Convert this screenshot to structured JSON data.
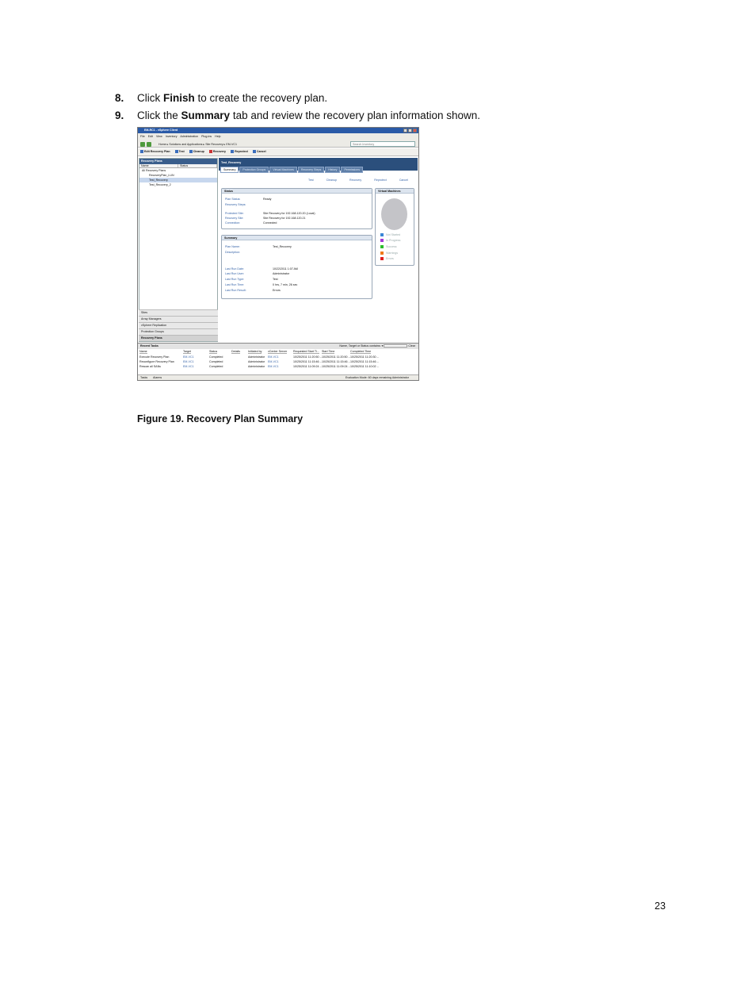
{
  "steps": [
    {
      "number": "8.",
      "before": "Click ",
      "bold": "Finish",
      "after": " to create the recovery plan."
    },
    {
      "number": "9.",
      "before": "Click the ",
      "bold": "Summary",
      "after": " tab and review the recovery plan information shown."
    }
  ],
  "caption": "Figure 19. Recovery Plan Summary",
  "page_number": "23",
  "screenshot": {
    "title": "EM-RC1 - vSphere Client",
    "menu": [
      "File",
      "Edit",
      "View",
      "Inventory",
      "Administration",
      "Plug-ins",
      "Help"
    ],
    "breadcrumb": [
      "Home",
      "Solutions and Applications",
      "Site Recovery",
      "EM-VC1"
    ],
    "search_placeholder": "Search Inventory",
    "toolbar": [
      "Edit Recovery Plan",
      "Test",
      "Cleanup",
      "Recovery",
      "Reprotect",
      "Cancel"
    ],
    "left_panel": {
      "title": "Recovery Plans",
      "columns": [
        "Name",
        "Status"
      ],
      "tree": [
        "All Recovery Plans",
        "RecoveryPlan_LUN",
        "Test_Recovery",
        "Test_Recovery_2"
      ],
      "selected_index": 2,
      "accordion": [
        "Sites",
        "Array Managers",
        "vSphere Replication",
        "Protection Groups",
        "Recovery Plans"
      ]
    },
    "plan_name": "Test_Recovery",
    "tabs": [
      "Summary",
      "Protection Groups",
      "Virtual Machines",
      "Recovery Steps",
      "History",
      "Permissions"
    ],
    "actions": [
      "Test",
      "Cleanup",
      "Recovery",
      "Reprotect",
      "Cancel"
    ],
    "status_box": {
      "title": "Status",
      "rows": [
        {
          "label": "Plan Status:",
          "value": "Ready"
        },
        {
          "label": "Recovery Steps:",
          "value": ""
        },
        {
          "label": "Protected Site:",
          "value": "Site Recovery for 192.168.120.20 (Local)"
        },
        {
          "label": "Recovery Site:",
          "value": "Site Recovery for 192.168.120.21"
        },
        {
          "label": "Connection:",
          "value": "Connected"
        }
      ]
    },
    "summary_box": {
      "title": "Summary",
      "rows": [
        {
          "label": "Plan Name:",
          "value": "Test_Recovery"
        },
        {
          "label": "Description:",
          "value": ""
        },
        {
          "label": "Last Run Date:",
          "value": "10/22/2011 1:07 AM"
        },
        {
          "label": "Last Run User:",
          "value": "Administrator"
        },
        {
          "label": "Last Run Type:",
          "value": "Test"
        },
        {
          "label": "Last Run Time:",
          "value": "0 hrs, 7 min, 26 sec"
        },
        {
          "label": "Last Run Result:",
          "value": "Errors"
        }
      ]
    },
    "vm_box": {
      "title": "Virtual Machines",
      "pie_color": "#c4c4c8",
      "legend": [
        {
          "label": "Not Started",
          "color": "#3a86d6"
        },
        {
          "label": "In Progress",
          "color": "#a43ad6"
        },
        {
          "label": "Success",
          "color": "#2cbd2c"
        },
        {
          "label": "Warnings",
          "color": "#f07a1a"
        },
        {
          "label": "Errors",
          "color": "#e02020"
        }
      ]
    },
    "tasks": {
      "title": "Recent Tasks",
      "filter": "Name, Target or Status contains: ▾",
      "clear": "Clear",
      "columns": [
        "Name",
        "Target",
        "Status",
        "Details",
        "Initiated by",
        "vCenter Server",
        "Requested Start Ti...",
        "Start Time",
        "Completed Time"
      ],
      "rows": [
        [
          "Execute Recovery Plan",
          "EM-VC1",
          "Completed",
          "",
          "Administrator",
          "EM-VC1",
          "10/25/2011 11:20:50 ...",
          "10/25/2011 11:20:50 ...",
          "10/25/2011 11:20:30 ..."
        ],
        [
          "Reconfigure Recovery Plan",
          "EM-VC1",
          "Completed",
          "",
          "Administrator",
          "EM-VC1",
          "10/25/2011 11:15:46 ...",
          "10/25/2011 11:15:46 ...",
          "10/25/2011 11:15:46 ..."
        ],
        [
          "Rescan all SANs",
          "EM-VC1",
          "Completed",
          "",
          "Administrator",
          "EM-VC1",
          "10/25/2011 11:09:24 ...",
          "10/25/2011 11:09:24 ...",
          "10/25/2011 11:10:02 ..."
        ]
      ]
    },
    "status_bar": {
      "tasks": "Tasks",
      "alarms": "Alarms",
      "right": "Evaluation Mode: 60 days remaining   Administrator"
    }
  }
}
